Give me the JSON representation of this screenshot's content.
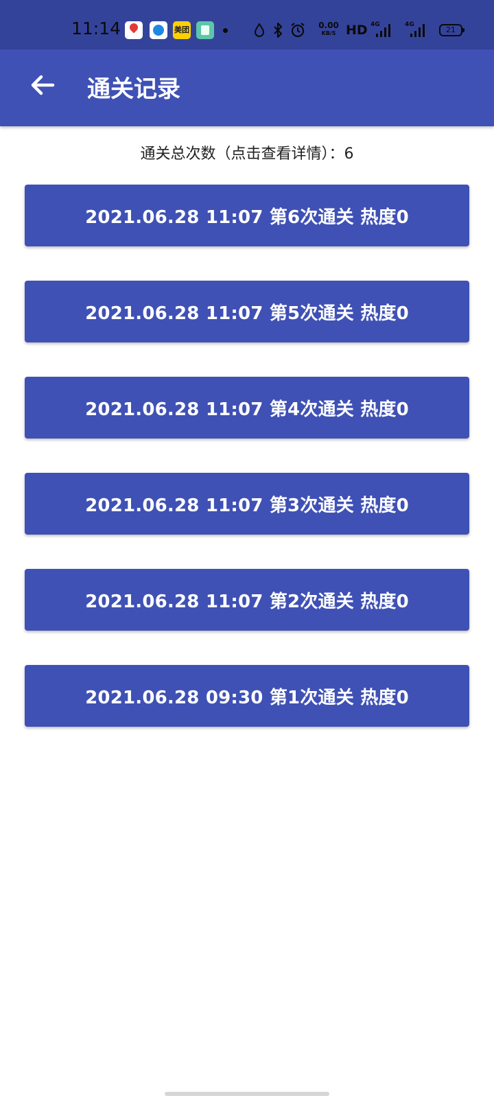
{
  "status_bar": {
    "time": "11:14",
    "notification_icons": [
      "map-pin-icon",
      "browser-icon",
      "meituan-icon",
      "reader-icon",
      "dot-icon"
    ],
    "meituan_label": "美团",
    "speed_value": "0.00",
    "speed_unit": "KB/S",
    "hd_label": "HD",
    "signal_label_1": "4G",
    "signal_label_2": "4G",
    "battery_level": "21"
  },
  "app_bar": {
    "back_icon": "arrow-left-icon",
    "title": "通关记录"
  },
  "summary": {
    "text": "通关总次数（点击查看详情）：6"
  },
  "records": [
    {
      "label": "2021.06.28 11:07 第6次通关 热度0"
    },
    {
      "label": "2021.06.28 11:07 第5次通关 热度0"
    },
    {
      "label": "2021.06.28 11:07 第4次通关 热度0"
    },
    {
      "label": "2021.06.28 11:07 第3次通关 热度0"
    },
    {
      "label": "2021.06.28 11:07 第2次通关 热度0"
    },
    {
      "label": "2021.06.28 09:30 第1次通关 热度0"
    }
  ],
  "colors": {
    "status_bar": "#34439a",
    "primary": "#3f51b5",
    "text_on_primary": "#ffffff",
    "body_text": "#212121"
  }
}
